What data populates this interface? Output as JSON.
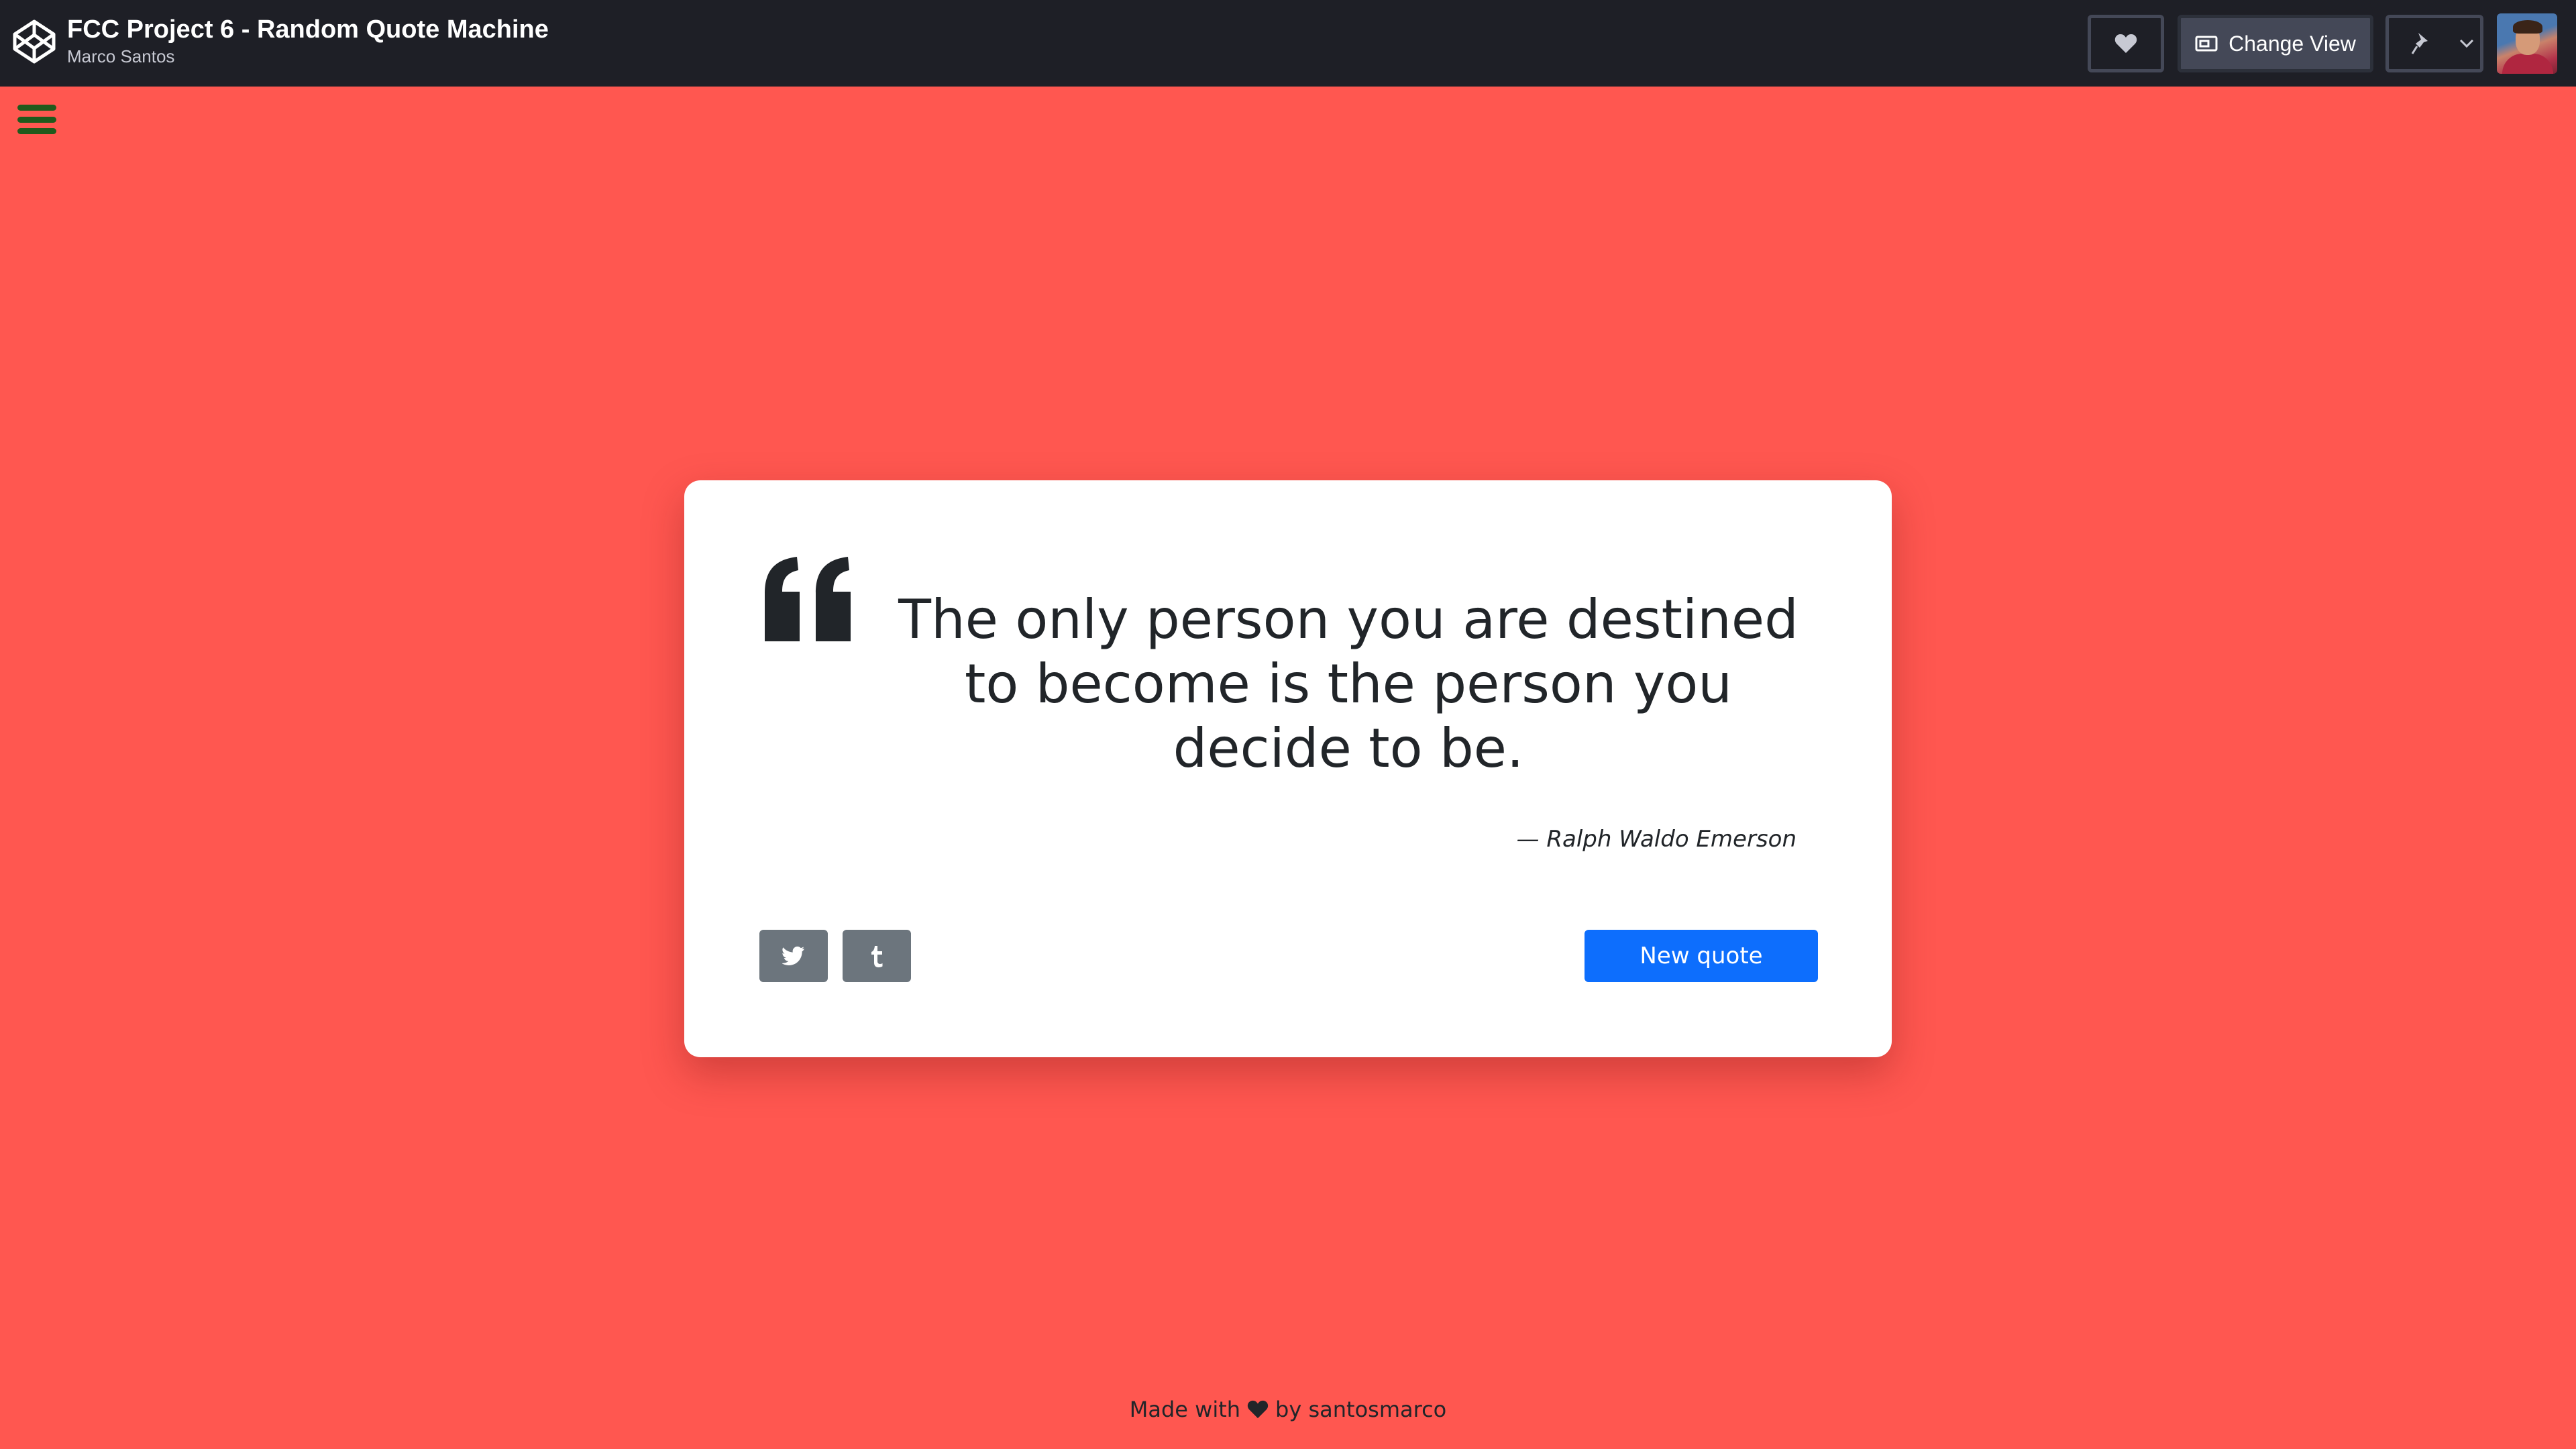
{
  "header": {
    "pen_title": "FCC Project 6 - Random Quote Machine",
    "author": "Marco Santos",
    "change_view_label": "Change View"
  },
  "quote": {
    "text": "The only person you are destined to become is the person you decide to be.",
    "author": "— Ralph Waldo Emerson"
  },
  "actions": {
    "new_quote_label": "New quote"
  },
  "footer": {
    "made_with": "Made with",
    "by": "by santosmarco"
  },
  "colors": {
    "background": "#ff5750",
    "topbar": "#1e1f26",
    "new_quote_button": "#0d6efd",
    "share_buttons": "#6c757d",
    "menu_icon": "#205a1c"
  },
  "icons": [
    "codepen-logo-icon",
    "heart-icon",
    "change-view-icon",
    "pin-icon",
    "chevron-down-icon",
    "menu-icon",
    "quote-left-icon",
    "twitter-icon",
    "tumblr-icon"
  ]
}
